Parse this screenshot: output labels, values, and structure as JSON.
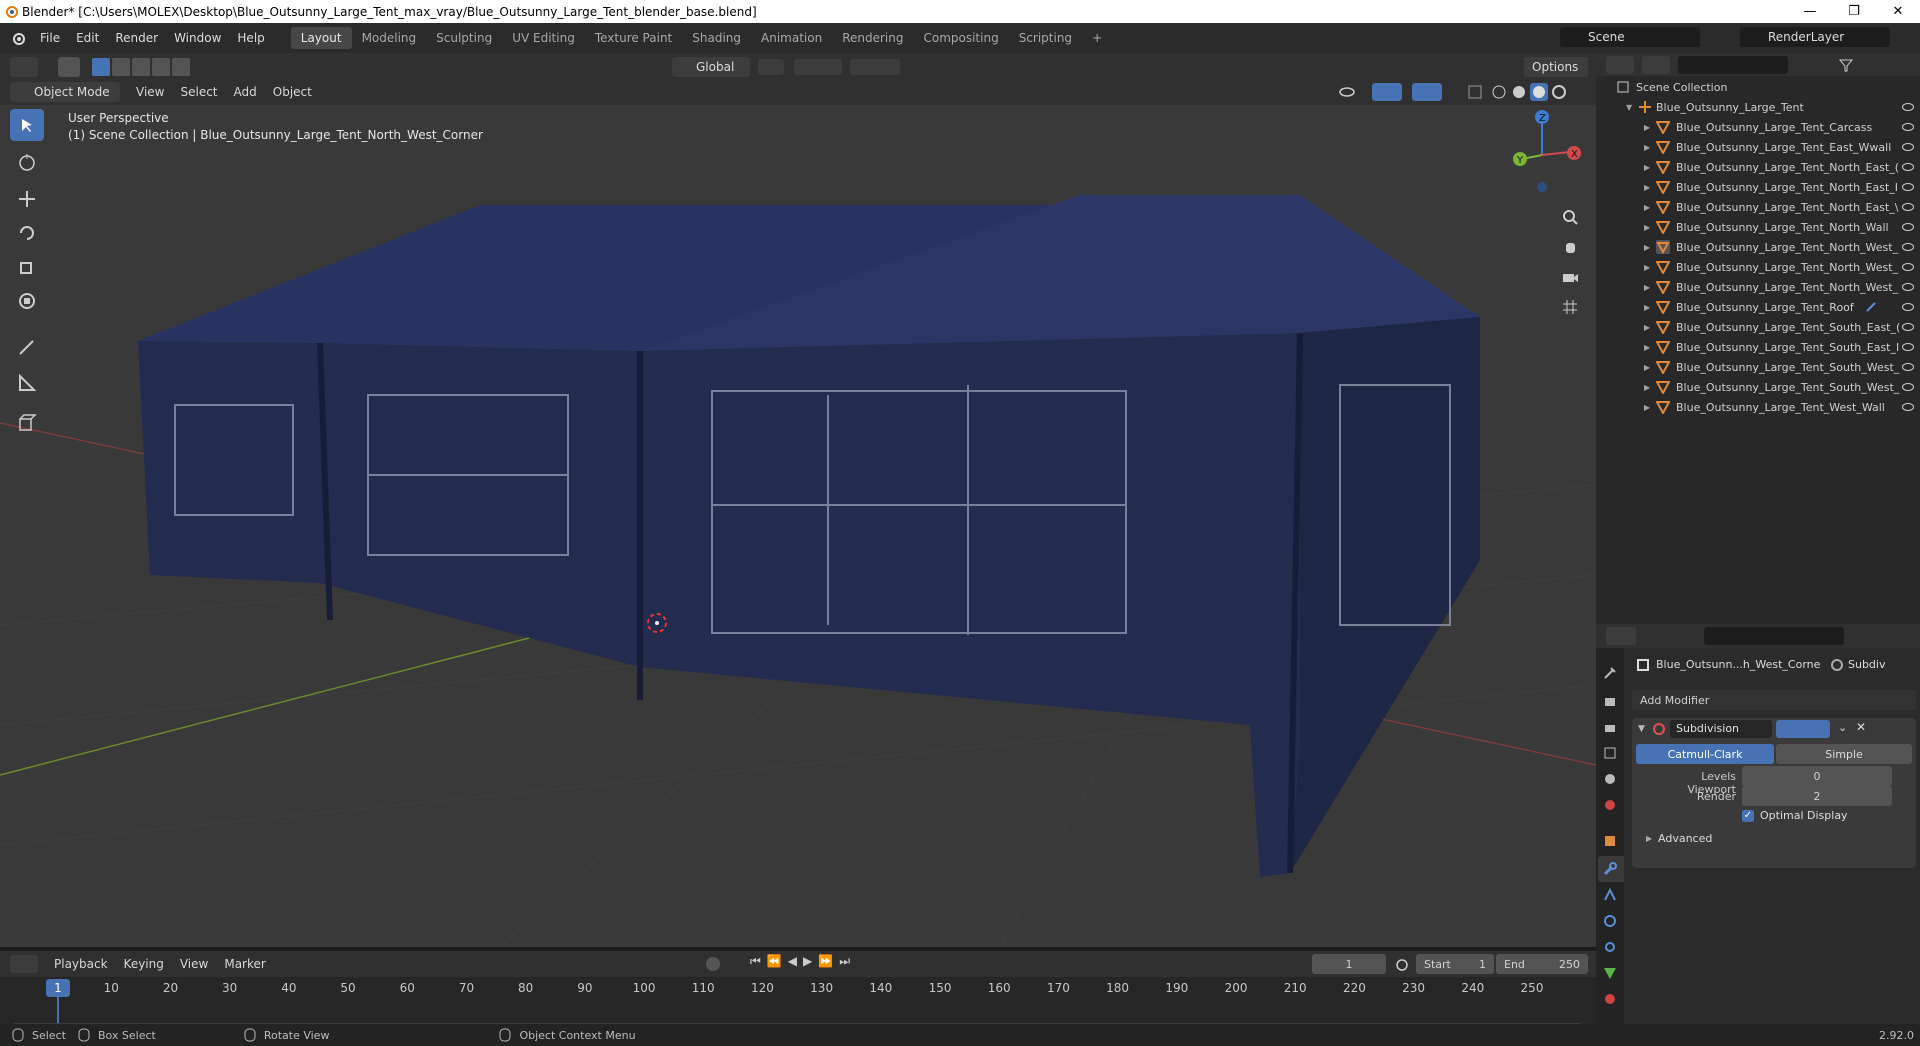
{
  "window": {
    "title": "Blender* [C:\\Users\\MOLEX\\Desktop\\Blue_Outsunny_Large_Tent_max_vray/Blue_Outsunny_Large_Tent_blender_base.blend]"
  },
  "menus": [
    "File",
    "Edit",
    "Render",
    "Window",
    "Help"
  ],
  "workspaces": [
    "Layout",
    "Modeling",
    "Sculpting",
    "UV Editing",
    "Texture Paint",
    "Shading",
    "Animation",
    "Rendering",
    "Compositing",
    "Scripting"
  ],
  "active_workspace": "Layout",
  "scene": {
    "name": "Scene",
    "render_layer": "RenderLayer"
  },
  "viewport_header": {
    "mode": "Object Mode",
    "menus": [
      "View",
      "Select",
      "Add",
      "Object"
    ],
    "transform_orientation": "Global",
    "options_label": "Options"
  },
  "viewport": {
    "perspective_label": "User Perspective",
    "collection_label": "(1) Scene Collection | Blue_Outsunny_Large_Tent_North_West_Corner",
    "gizmo_axes": [
      "X",
      "Y",
      "Z"
    ]
  },
  "outliner": {
    "root": "Scene Collection",
    "parent": "Blue_Outsunny_Large_Tent",
    "items": [
      "Blue_Outsunny_Large_Tent_Carcass",
      "Blue_Outsunny_Large_Tent_East_Wwall",
      "Blue_Outsunny_Large_Tent_North_East_(",
      "Blue_Outsunny_Large_Tent_North_East_I",
      "Blue_Outsunny_Large_Tent_North_East_\\",
      "Blue_Outsunny_Large_Tent_North_Wall",
      "Blue_Outsunny_Large_Tent_North_West_",
      "Blue_Outsunny_Large_Tent_North_West_",
      "Blue_Outsunny_Large_Tent_North_West_",
      "Blue_Outsunny_Large_Tent_Roof",
      "Blue_Outsunny_Large_Tent_South_East_(",
      "Blue_Outsunny_Large_Tent_South_East_I",
      "Blue_Outsunny_Large_Tent_South_West_",
      "Blue_Outsunny_Large_Tent_South_West_",
      "Blue_Outsunny_Large_Tent_West_Wall"
    ],
    "selected_index": 6
  },
  "properties": {
    "object_name": "Blue_Outsunn...h_West_Corne",
    "modifier_short": "Subdiv",
    "add_modifier": "Add Modifier",
    "modifier_name": "Subdivision",
    "catmull_clark": "Catmull-Clark",
    "simple": "Simple",
    "levels_viewport_label": "Levels Viewport",
    "levels_viewport_value": "0",
    "render_label": "Render",
    "render_value": "2",
    "optimal_display": "Optimal Display",
    "advanced": "Advanced"
  },
  "timeline": {
    "menus": [
      "Playback",
      "Keying",
      "View",
      "Marker"
    ],
    "current_frame": "1",
    "start_label": "Start",
    "start_value": "1",
    "end_label": "End",
    "end_value": "250",
    "ticks": [
      "1",
      "10",
      "20",
      "30",
      "40",
      "50",
      "60",
      "70",
      "80",
      "90",
      "100",
      "110",
      "120",
      "130",
      "140",
      "150",
      "160",
      "170",
      "180",
      "190",
      "200",
      "210",
      "220",
      "230",
      "240",
      "250"
    ]
  },
  "statusbar": {
    "select": "Select",
    "box_select": "Box Select",
    "rotate_view": "Rotate View",
    "context_menu": "Object Context Menu",
    "version": "2.92.0"
  },
  "colors": {
    "accent": "#4772b3",
    "tent": "#26315a",
    "object_icon": "#e08a3c"
  }
}
